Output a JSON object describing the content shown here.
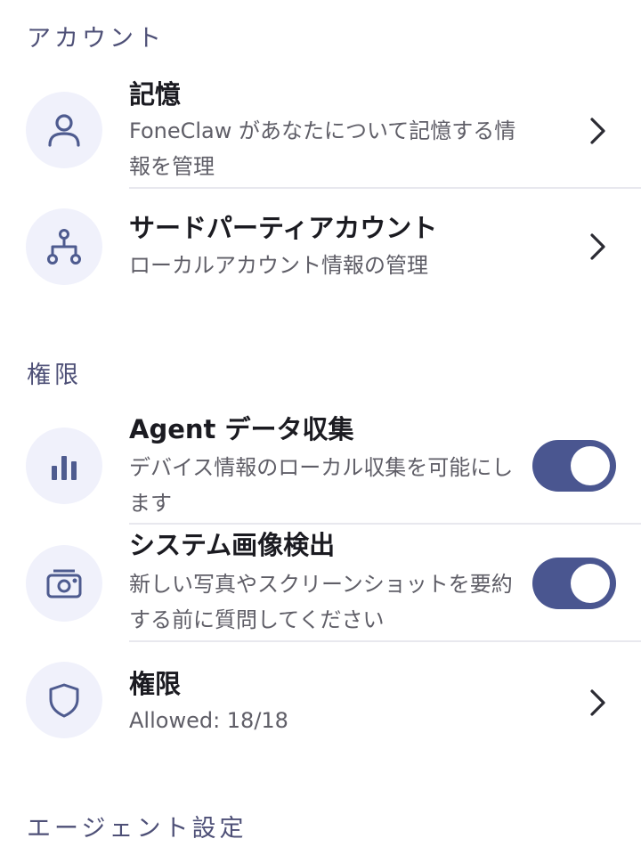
{
  "sections": {
    "account": {
      "header": "アカウント",
      "memory": {
        "title": "記憶",
        "subtitle": "FoneClaw があなたについて記憶する情報を管理",
        "icon": "person-icon"
      },
      "third_party": {
        "title": "サードパーティアカウント",
        "subtitle": "ローカルアカウント情報の管理",
        "icon": "account-tree-icon"
      }
    },
    "permissions": {
      "header": "権限",
      "data_collection": {
        "title": "Agent データ収集",
        "subtitle": "デバイス情報のローカル収集を可能にします",
        "enabled": true,
        "icon": "bar-chart-icon"
      },
      "image_detection": {
        "title": "システム画像検出",
        "subtitle": "新しい写真やスクリーンショットを要約する前に質問してください",
        "enabled": true,
        "icon": "camera-icon"
      },
      "permissions_row": {
        "title": "権限",
        "subtitle": "Allowed: 18/18",
        "icon": "shield-icon"
      }
    },
    "agent_settings": {
      "header": "エージェント設定"
    }
  },
  "colors": {
    "accent": "#4a5690",
    "icon_bg": "#f0f1fb",
    "icon_stroke": "#4e5b8f",
    "section_header": "#4e5077"
  }
}
